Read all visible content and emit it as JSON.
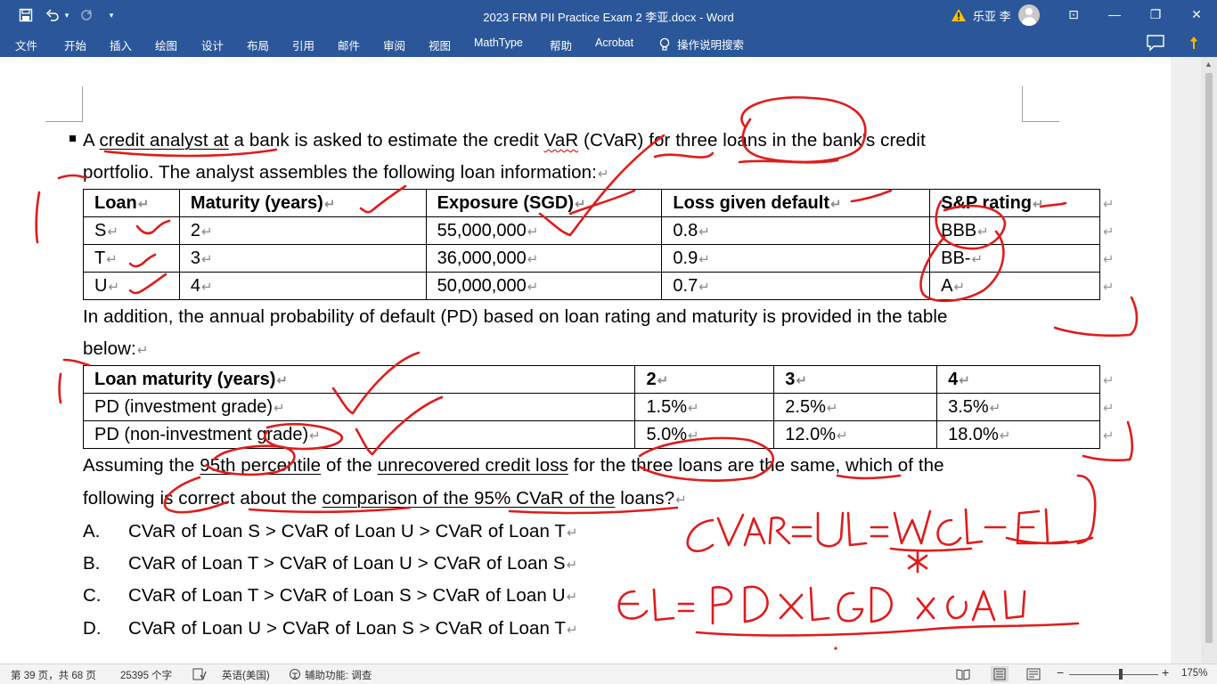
{
  "window": {
    "title": "2023 FRM PII Practice Exam 2 李亚.docx  -  Word",
    "user": "乐亚 李",
    "save_icon": "save-icon",
    "undo_icon": "undo-icon",
    "redo_icon": "redo-icon",
    "qat_more": "▾",
    "btn_ribbon_display": "⊡",
    "btn_minimize": "—",
    "btn_restore": "❐",
    "btn_close": "✕",
    "accent": "#2b579a"
  },
  "ribbon": {
    "tabs": [
      "文件",
      "开始",
      "插入",
      "绘图",
      "设计",
      "布局",
      "引用",
      "邮件",
      "审阅",
      "视图",
      "MathType",
      "帮助",
      "Acrobat"
    ],
    "tell_me": "操作说明搜索"
  },
  "doc": {
    "intro_1_a": "A ",
    "intro_1_b": "credit analyst at",
    "intro_1_c": " a bank is asked to estimate the credit ",
    "intro_1_d": "VaR",
    "intro_1_e": " (CVaR) for three loans in the bank's credit",
    "intro_2": "portfolio. The analyst assembles the following loan information:",
    "table1": {
      "headers": [
        "Loan",
        "Maturity (years)",
        "Exposure (SGD)",
        "Loss given default",
        "S&P rating"
      ],
      "rows": [
        [
          "S",
          "2",
          "55,000,000",
          "0.8",
          "BBB"
        ],
        [
          "T",
          "3",
          "36,000,000",
          "0.9",
          "BB-"
        ],
        [
          "U",
          "4",
          "50,000,000",
          "0.7",
          "A"
        ]
      ]
    },
    "mid_1": "In addition, the annual probability of default (PD) based on loan rating and maturity is provided in the table",
    "mid_2": "below:",
    "table2": {
      "headers": [
        "Loan maturity (years)",
        "2",
        "3",
        "4"
      ],
      "rows": [
        [
          "PD (investment grade)",
          "1.5%",
          "2.5%",
          "3.5%"
        ],
        [
          "PD (non-investment grade)",
          "5.0%",
          "12.0%",
          "18.0%"
        ]
      ]
    },
    "q_1_a": "Assuming the ",
    "q_1_b": "95th percentile",
    "q_1_c": " of the ",
    "q_1_d": "unrecovered credit loss",
    "q_1_e": " for the three loans are the same, which of the",
    "q_2_a": "following is correct about the ",
    "q_2_b": "comparison of the 95% CVaR of the",
    "q_2_c": " loans?",
    "options": [
      {
        "letter": "A.",
        "text": "CVaR of Loan S > CVaR of Loan U > CVaR of Loan T"
      },
      {
        "letter": "B.",
        "text": "CVaR of Loan T > CVaR of Loan U > CVaR of Loan S"
      },
      {
        "letter": "C.",
        "text": "CVaR of Loan T > CVaR of Loan S > CVaR of Loan U"
      },
      {
        "letter": "D.",
        "text": "CVaR of Loan U > CVaR of Loan S > CVaR of Loan T"
      }
    ],
    "para_mark": "↵",
    "ink_color": "#e01b1b",
    "ink_note_1": "CVaR = UL = WCL − EL",
    "ink_note_2": "EL = PD × LGD × EAD"
  },
  "status": {
    "page": "第 39 页，共 68 页",
    "words": "25395 个字",
    "language": "英语(美国)",
    "accessibility": "辅助功能: 调查",
    "zoom": "175%",
    "zoom_out": "−",
    "zoom_in": "+"
  }
}
